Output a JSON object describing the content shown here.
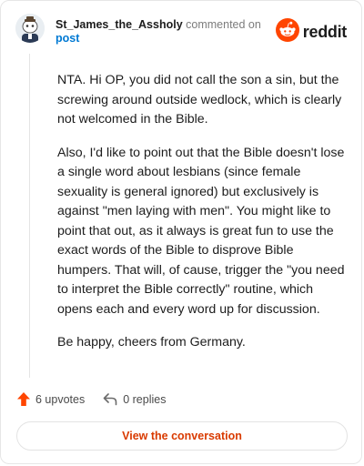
{
  "comment": {
    "author": "St_James_the_Assholy",
    "action": "commented on",
    "post_link": "post",
    "paragraphs": [
      "NTA. Hi OP, you did not call the son a sin, but the screwing around outside wedlock, which is clearly not welcomed in the Bible.",
      "Also, I'd like to point out that the Bible doesn't lose a single word about lesbians (since female sexuality is general ignored) but exclusively is against \"men laying with men\". You might like to point that out, as it always is great fun to use the exact words of the Bible to disprove Bible humpers. That will, of cause, trigger the \"you need to interpret the Bible correctly\" routine, which opens each and every word up for discussion.",
      "Be happy, cheers from Germany."
    ],
    "upvotes": "6 upvotes",
    "replies": "0 replies"
  },
  "brand": {
    "name": "reddit",
    "color": "#ff4500"
  },
  "cta": {
    "label": "View the conversation"
  },
  "colors": {
    "upvote": "#ff4500",
    "link": "#0079d3",
    "cta_text": "#d93a00"
  },
  "icons": [
    "user-avatar-icon",
    "reddit-snoo-icon",
    "upvote-arrow-icon",
    "reply-arrow-icon"
  ]
}
